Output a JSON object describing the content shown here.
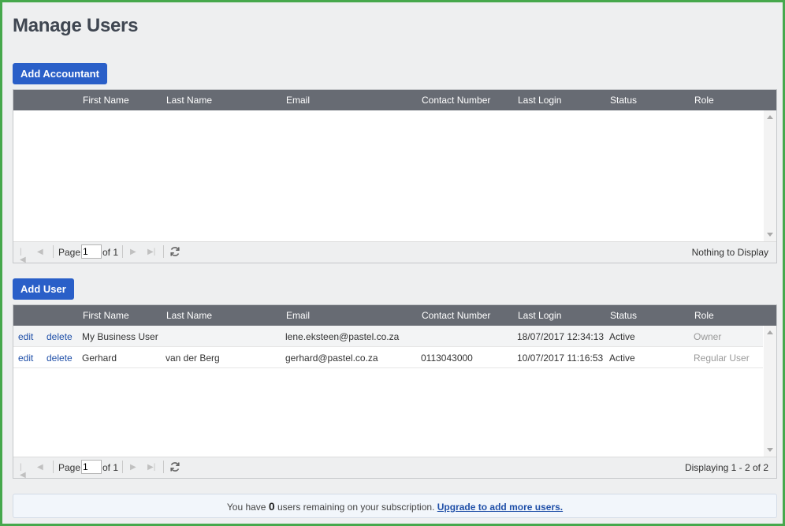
{
  "page": {
    "title": "Manage Users"
  },
  "accountants": {
    "add_button": "Add Accountant",
    "columns": [
      "First Name",
      "Last Name",
      "Email",
      "Contact Number",
      "Last Login",
      "Status",
      "Role"
    ],
    "rows": [],
    "pager": {
      "page_label": "Page",
      "page_value": "1",
      "of_label": "of 1",
      "display_text": "Nothing to Display"
    }
  },
  "users": {
    "add_button": "Add User",
    "columns": [
      "First Name",
      "Last Name",
      "Email",
      "Contact Number",
      "Last Login",
      "Status",
      "Role"
    ],
    "rows": [
      {
        "edit": "edit",
        "delete": "delete",
        "first_name": "My Business User",
        "last_name": "",
        "email": "lene.eksteen@pastel.co.za",
        "contact": "",
        "last_login": "18/07/2017 12:34:13",
        "status": "Active",
        "role": "Owner"
      },
      {
        "edit": "edit",
        "delete": "delete",
        "first_name": "Gerhard",
        "last_name": "van der Berg",
        "email": "gerhard@pastel.co.za",
        "contact": "0113043000",
        "last_login": "10/07/2017 11:16:53",
        "status": "Active",
        "role": "Regular User"
      }
    ],
    "pager": {
      "page_label": "Page",
      "page_value": "1",
      "of_label": "of 1",
      "display_text": "Displaying 1 - 2 of 2"
    }
  },
  "notice": {
    "prefix": "You have",
    "count": "0",
    "suffix": "users remaining on your subscription.",
    "link": "Upgrade to add more users."
  }
}
